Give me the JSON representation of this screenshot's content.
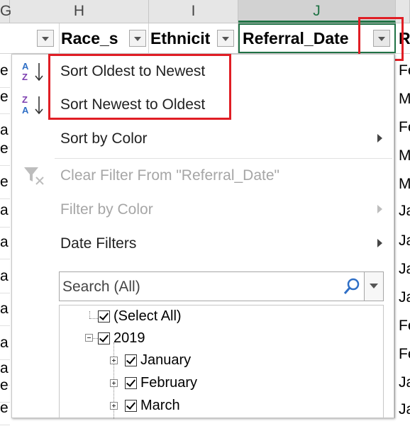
{
  "columns": {
    "letters": [
      "G",
      "H",
      "I",
      "J"
    ],
    "fields": [
      "Race_s",
      "Ethnicit",
      "Referral_Date",
      "R"
    ]
  },
  "left_cells": [
    "e",
    "e",
    "a",
    "e",
    "e",
    "a",
    "a",
    "a",
    "a",
    "a",
    "a",
    "e",
    "e"
  ],
  "right_cells": [
    "Fe",
    "M",
    "Fe",
    "M",
    "M",
    "Ja",
    "Ja",
    "Ja",
    "Ja",
    "Fe",
    "Fe",
    "Ja",
    "Ja"
  ],
  "menu": {
    "sort_asc": "Sort Oldest to Newest",
    "sort_desc": "Sort Newest to Oldest",
    "sort_color": "Sort by Color",
    "clear_filter": "Clear Filter From \"Referral_Date\"",
    "filter_color": "Filter by Color",
    "date_filters": "Date Filters"
  },
  "search": {
    "placeholder": "Search (All)"
  },
  "tree": {
    "select_all": "(Select All)",
    "year": "2019",
    "months": [
      "January",
      "February",
      "March"
    ]
  },
  "colors": {
    "highlight": "#e01e25",
    "accent": "#217346"
  }
}
